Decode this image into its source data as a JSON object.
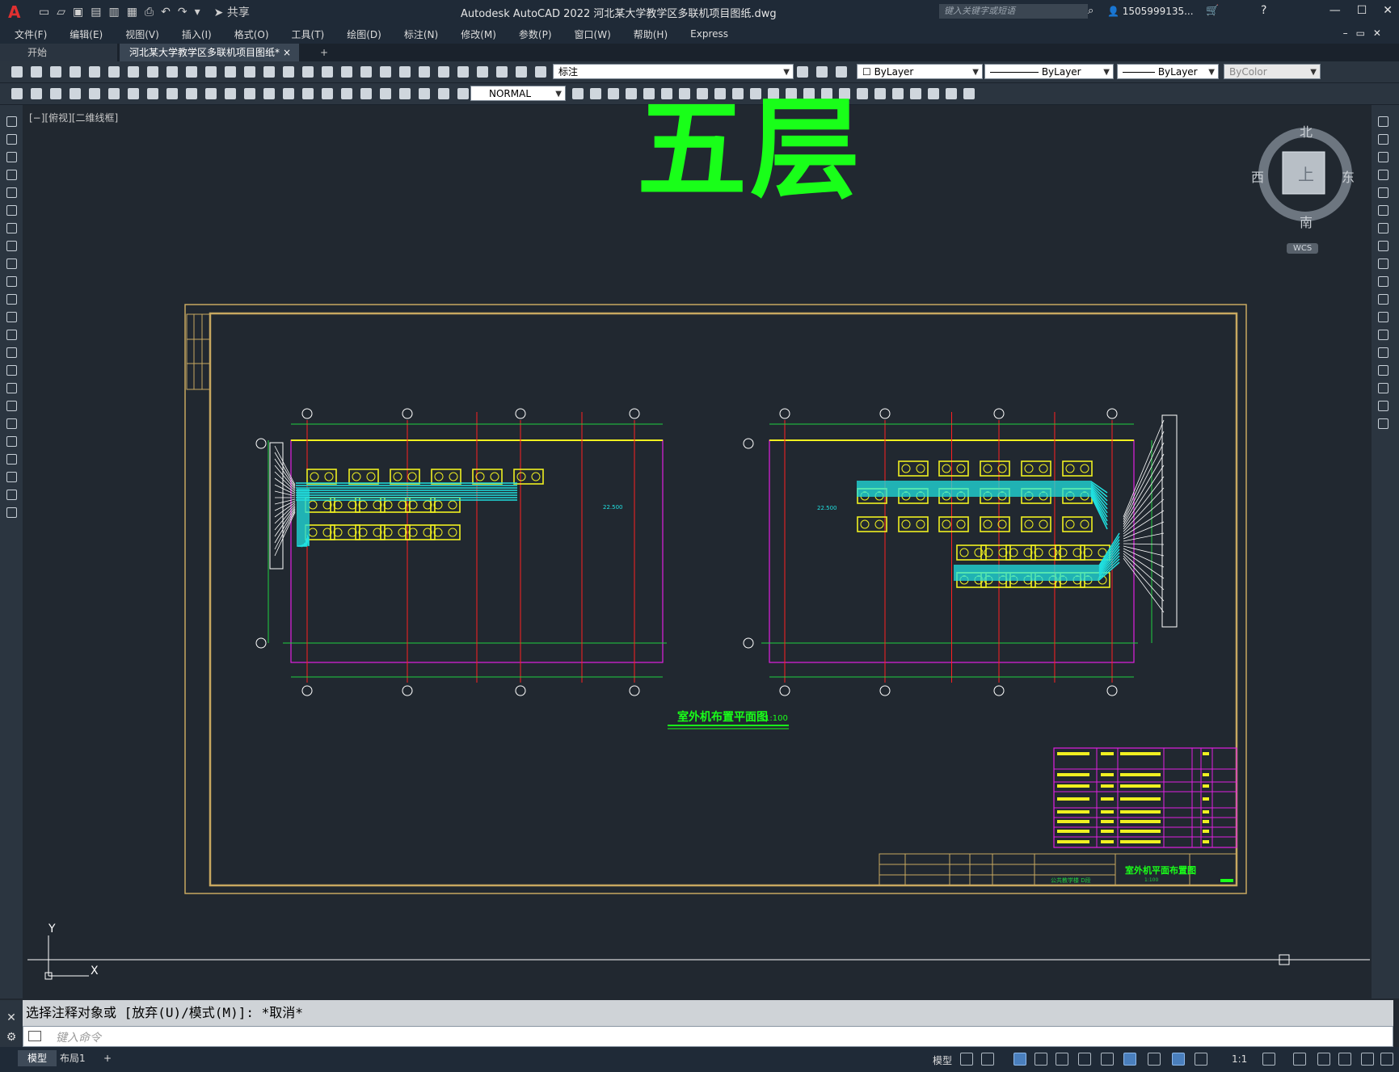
{
  "app": {
    "title": "Autodesk AutoCAD 2022    河北某大学教学区多联机项目图纸.dwg",
    "logo": "A",
    "share_label": "共享",
    "search_placeholder": "键入关键字或短语",
    "user": "1505999135..."
  },
  "menu": [
    "文件(F)",
    "编辑(E)",
    "视图(V)",
    "插入(I)",
    "格式(O)",
    "工具(T)",
    "绘图(D)",
    "标注(N)",
    "修改(M)",
    "参数(P)",
    "窗口(W)",
    "帮助(H)",
    "Express"
  ],
  "tabs": {
    "start": "开始",
    "doc": "河北某大学教学区多联机项目图纸*",
    "close": "×",
    "add": "+"
  },
  "toolbar": {
    "layer_combo": "标注",
    "color_combo": "ByLayer",
    "linetype_combo": "ByLayer",
    "lineweight_combo": "ByLayer",
    "plotstyle_combo": "ByColor",
    "dimstyle_combo": "NORMAL"
  },
  "viewport": {
    "label": "[−][俯视][二维线框]"
  },
  "drawing": {
    "floor_title": "五层",
    "plan_title": "室外机布置平面图",
    "plan_scale": "1:100",
    "left_dim_label": "22.500",
    "right_dim_label": "22.500",
    "axis_bottom_left": "Ⓐ",
    "titleblock_name": "室外机平面布置图",
    "titleblock_scale": "1:100",
    "titleblock_project": "公共教学楼 D段"
  },
  "compass": {
    "north": "北",
    "south": "南",
    "east": "东",
    "west": "西",
    "center": "上",
    "wcs": "WCS"
  },
  "ucs": {
    "y": "Y",
    "x": "X"
  },
  "command": {
    "history": "选择注释对象或 [放弃(U)/模式(M)]: *取消*",
    "placeholder": "键入命令"
  },
  "status": {
    "model_tab": "模型",
    "layout1_tab": "布局1",
    "add": "+",
    "model_label": "模型",
    "scale": "1:1"
  },
  "colors": {
    "cad_bg": "#212830",
    "title_green": "#19ff19",
    "grid_red": "#ff2020",
    "frame_gold": "#c8a860",
    "dim_green": "#20d040",
    "pipe_cyan": "#20e0e0",
    "unit_yellow": "#f0f020",
    "magenta": "#e020e0"
  }
}
